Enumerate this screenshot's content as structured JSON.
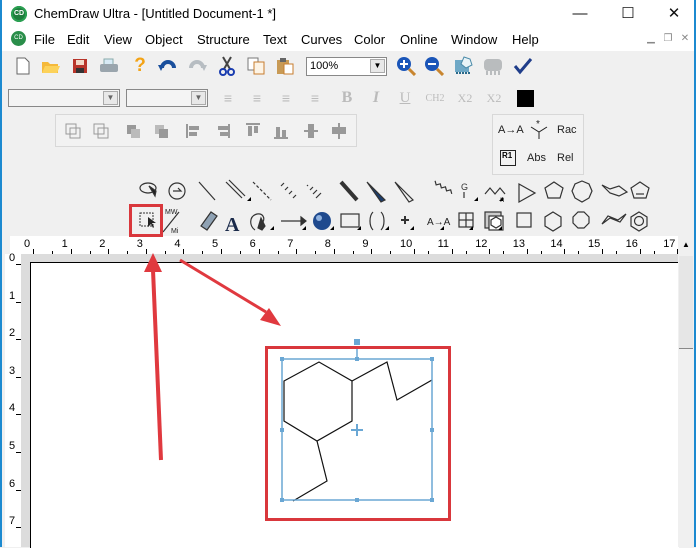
{
  "window": {
    "title": "ChemDraw Ultra - [Untitled Document-1 *]",
    "app_icon_text": "CD",
    "controls": [
      "minimize",
      "maximize",
      "close"
    ]
  },
  "menubar": {
    "items": [
      "File",
      "Edit",
      "View",
      "Object",
      "Structure",
      "Text",
      "Curves",
      "Color",
      "Online",
      "Window",
      "Help"
    ],
    "mnemonics": [
      "F",
      "E",
      "V",
      "O",
      "S",
      "x",
      "C",
      "l",
      "n",
      "W",
      "H"
    ],
    "mdi_controls": [
      "minimize",
      "restore",
      "close"
    ]
  },
  "toolbar_general": {
    "icons": [
      "new-document",
      "open-folder",
      "save",
      "print",
      "help",
      "undo",
      "redo",
      "cut",
      "copy",
      "paste"
    ],
    "zoom_value": "100%",
    "icons_after_zoom": [
      "zoom-in",
      "zoom-out",
      "structure-cleanup",
      "structure-disabled",
      "check"
    ]
  },
  "toolbar_text": {
    "font_value": "",
    "size_value": "",
    "align": [
      "align-left",
      "align-center",
      "align-right",
      "justify"
    ],
    "styles": {
      "bold": "B",
      "italic": "I",
      "underline": "U",
      "formula": "CH2",
      "subscript": "X2",
      "superscript": "X2"
    },
    "color_swatch": "#000000"
  },
  "toolbar_object": {
    "icons": [
      "group",
      "ungroup",
      "bring-to-front",
      "send-to-back",
      "align-left",
      "align-right",
      "align-top",
      "align-bottom",
      "center-vertical",
      "center-horizontal"
    ]
  },
  "stereo_panel": {
    "map_label": "A→A",
    "rac_label": "Rac",
    "r1_label": "R1",
    "abs_label": "Abs",
    "rel_label": "Rel"
  },
  "tools_row1": [
    "lasso",
    "rotate",
    "single-bond",
    "multiple-bond",
    "dashed-bond",
    "hashed-bond",
    "hashed-wedge",
    "bold-bond",
    "wedge-bond",
    "hollow-wedge",
    "wavy-bond",
    "query-g",
    "chain",
    "triangle",
    "cyclopentane",
    "cycloheptane",
    "chair-cyclohexane",
    "cyclopentadiene"
  ],
  "tools_row2": [
    "marquee",
    "mass-fragment",
    "eraser",
    "text",
    "pen",
    "arrow",
    "orbital",
    "rectangle",
    "brackets",
    "charge",
    "atom-map",
    "table",
    "template",
    "square",
    "cyclohexane",
    "cyclooctane",
    "chair-cyclohexane-2",
    "benzene"
  ],
  "tool_labels": {
    "query": "G",
    "mass_top": "MW",
    "mass_bottom": "Mi",
    "text": "A",
    "atom_map": "A→A",
    "charge": "+"
  },
  "ruler_h": [
    "0",
    "1",
    "2",
    "3",
    "4",
    "5",
    "6",
    "7",
    "8",
    "9",
    "10",
    "11",
    "12",
    "13",
    "14",
    "15",
    "16",
    "17"
  ],
  "ruler_v": [
    "0",
    "1",
    "2",
    "3",
    "4",
    "5",
    "6",
    "7"
  ],
  "annotation": {
    "highlight_color": "#d9373c",
    "selection_color": "#6aa7d4"
  }
}
